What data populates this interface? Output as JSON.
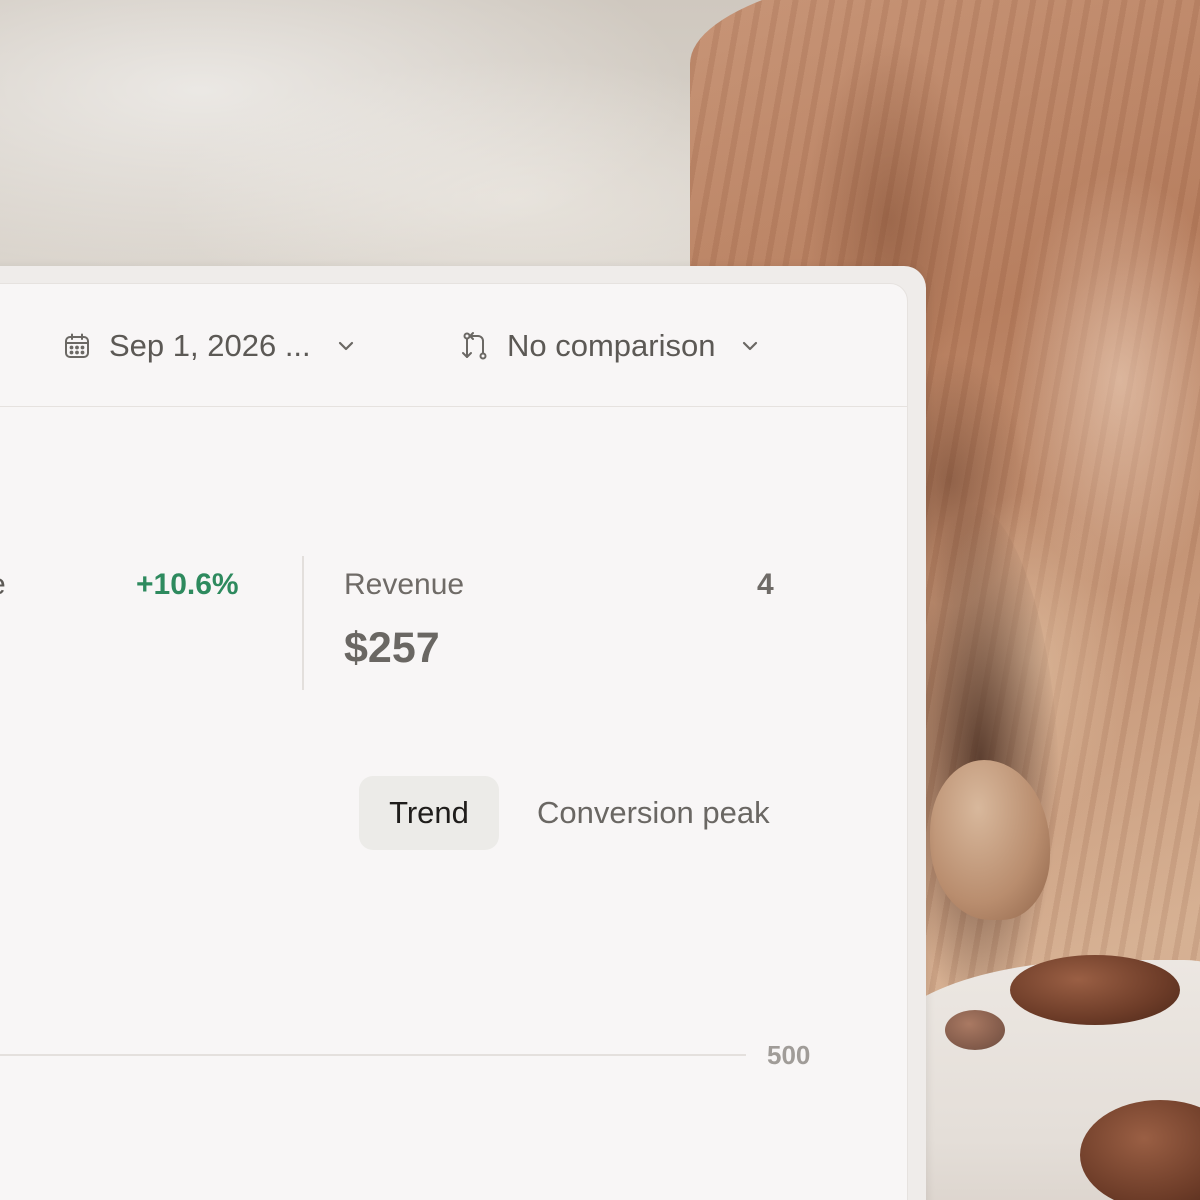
{
  "toolbar": {
    "date_range": "Sep 1, 2026 ...",
    "comparison": "No comparison"
  },
  "metrics": {
    "left": {
      "label": "e",
      "delta": "+10.6%",
      "delta_color": "#2e8a5e"
    },
    "right": {
      "label": "Revenue",
      "value": "$257",
      "aside": "4"
    }
  },
  "tabs": [
    {
      "label": "Trend",
      "active": true
    },
    {
      "label": "Conversion peak",
      "active": false
    }
  ],
  "chart": {
    "y_tick": "500"
  },
  "icons": {
    "date": "calendar-icon",
    "compare": "compare-arrows-icon",
    "dropdown": "chevron-down-icon"
  }
}
